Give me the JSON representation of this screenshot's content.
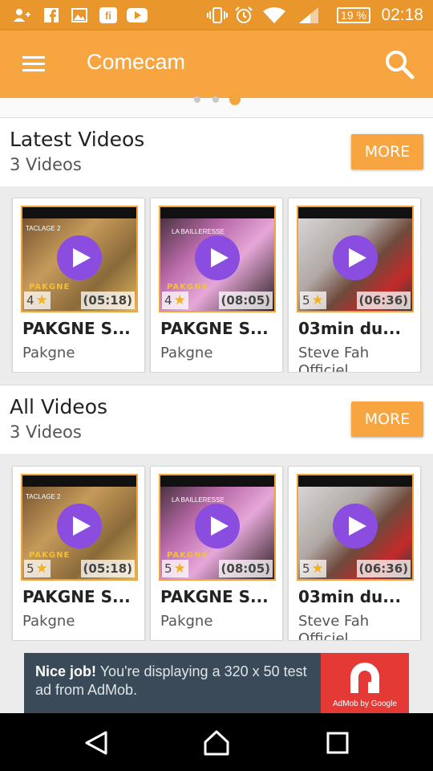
{
  "status_bar": {
    "battery": "19 %",
    "time": "02:18",
    "icons": [
      "add-person-icon",
      "facebook-icon",
      "gallery-icon",
      "fi-icon",
      "youtube-icon",
      "vibrate-icon",
      "alarm-icon",
      "wifi-icon",
      "signal-icon"
    ]
  },
  "app_bar": {
    "title": "Comecam",
    "menu_icon": "hamburger-menu-icon",
    "search_icon": "search-icon"
  },
  "carousel": {
    "pages": 3,
    "active_page": 3
  },
  "sections": [
    {
      "title": "Latest Videos",
      "count": "3 Videos",
      "more_label": "MORE",
      "videos": [
        {
          "rating": "4",
          "duration": "(05:18)",
          "title": "PAKGNE S...",
          "channel": "Pakgne",
          "thumb_label": "TACLAGE 2",
          "thumb_brand": "PAKGNE"
        },
        {
          "rating": "4",
          "duration": "(08:05)",
          "title": "PAKGNE S...",
          "channel": "Pakgne",
          "thumb_label": "LA BAILLERESSE",
          "thumb_brand": "PAKGNE"
        },
        {
          "rating": "5",
          "duration": "(06:36)",
          "title": "03min du...",
          "channel": "Steve Fah Officiel",
          "thumb_label": "",
          "thumb_brand": ""
        }
      ]
    },
    {
      "title": "All Videos",
      "count": "3 Videos",
      "more_label": "MORE",
      "videos": [
        {
          "rating": "5",
          "duration": "(05:18)",
          "title": "PAKGNE S...",
          "channel": "Pakgne",
          "thumb_label": "TACLAGE 2",
          "thumb_brand": "PAKGNE"
        },
        {
          "rating": "5",
          "duration": "(08:05)",
          "title": "PAKGNE S...",
          "channel": "Pakgne",
          "thumb_label": "LA BAILLERESSE",
          "thumb_brand": "PAKGNE"
        },
        {
          "rating": "5",
          "duration": "(06:36)",
          "title": "03min du...",
          "channel": "Steve Fah Officiel",
          "thumb_label": "",
          "thumb_brand": ""
        }
      ]
    }
  ],
  "ad": {
    "headline": "Nice job!",
    "body": "You're displaying a 320 x 50 test ad from AdMob.",
    "logo_caption": "AdMob by Google"
  },
  "nav_bar": {
    "icons": [
      "back-icon",
      "home-icon",
      "recents-icon"
    ]
  },
  "colors": {
    "primary": "#f7a541",
    "status_bar": "#e9962d",
    "play": "#8a4de0",
    "ad_bg": "#3b4a58",
    "ad_logo": "#e53935"
  }
}
